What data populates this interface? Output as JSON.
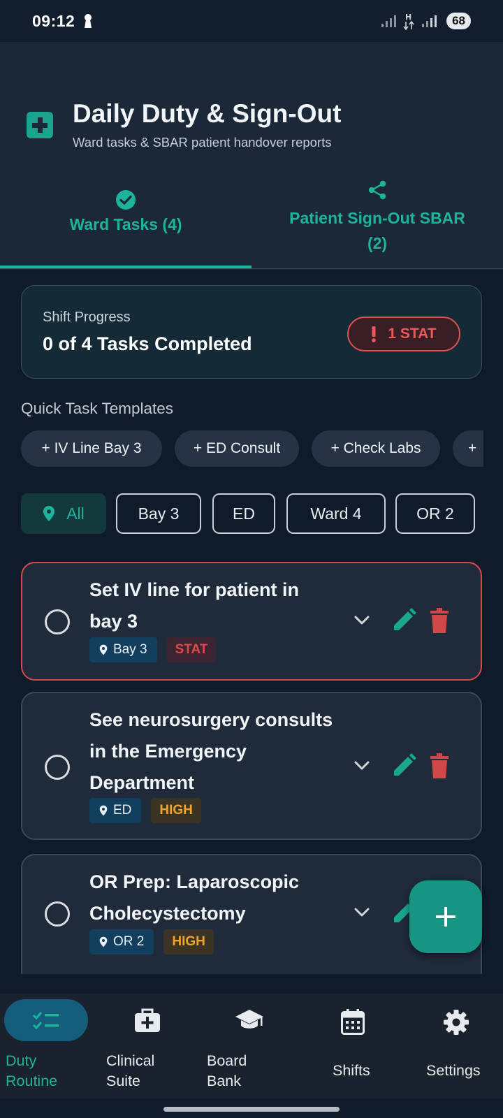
{
  "status_bar": {
    "time": "09:12",
    "battery": "68"
  },
  "header": {
    "title": "Daily Duty & Sign-Out",
    "subtitle": "Ward tasks & SBAR patient handover reports"
  },
  "tabs": [
    {
      "label": "Ward Tasks (4)",
      "icon": "check-circle-icon",
      "active": true
    },
    {
      "label_line1": "Patient Sign-Out SBAR",
      "label_line2": "(2)",
      "icon": "share-icon",
      "active": false
    }
  ],
  "progress": {
    "label": "Shift Progress",
    "value": "0 of 4 Tasks Completed",
    "stat_badge": "1 STAT"
  },
  "quick_templates": {
    "title": "Quick Task Templates",
    "chips": [
      "+ IV Line Bay 3",
      "+ ED Consult",
      "+ Check Labs",
      "+"
    ]
  },
  "filters": [
    "All",
    "Bay 3",
    "ED",
    "Ward 4",
    "OR 2"
  ],
  "tasks": [
    {
      "title": "Set IV line for patient in bay 3",
      "location": "Bay 3",
      "priority": "STAT"
    },
    {
      "title": "See neurosurgery consults in the Emergency Department",
      "location": "ED",
      "priority": "HIGH"
    },
    {
      "title": "OR Prep: Laparoscopic Cholecystectomy",
      "location": "OR 2",
      "priority": "HIGH"
    }
  ],
  "bottom_nav": [
    {
      "label_line1": "Duty",
      "label_line2": "Routine",
      "icon": "checklist-icon",
      "active": true
    },
    {
      "label_line1": "Clinical",
      "label_line2": "Suite",
      "icon": "medical-bag-icon",
      "active": false
    },
    {
      "label_line1": "Board",
      "label_line2": "Bank",
      "icon": "graduation-cap-icon",
      "active": false
    },
    {
      "label": "Shifts",
      "icon": "calendar-icon",
      "active": false
    },
    {
      "label": "Settings",
      "icon": "gear-icon",
      "active": false
    }
  ],
  "colors": {
    "accent": "#19b59c",
    "stat": "#e0484b",
    "high": "#f0a42b",
    "background": "#0f1a2a",
    "card": "#1f2a3a"
  }
}
